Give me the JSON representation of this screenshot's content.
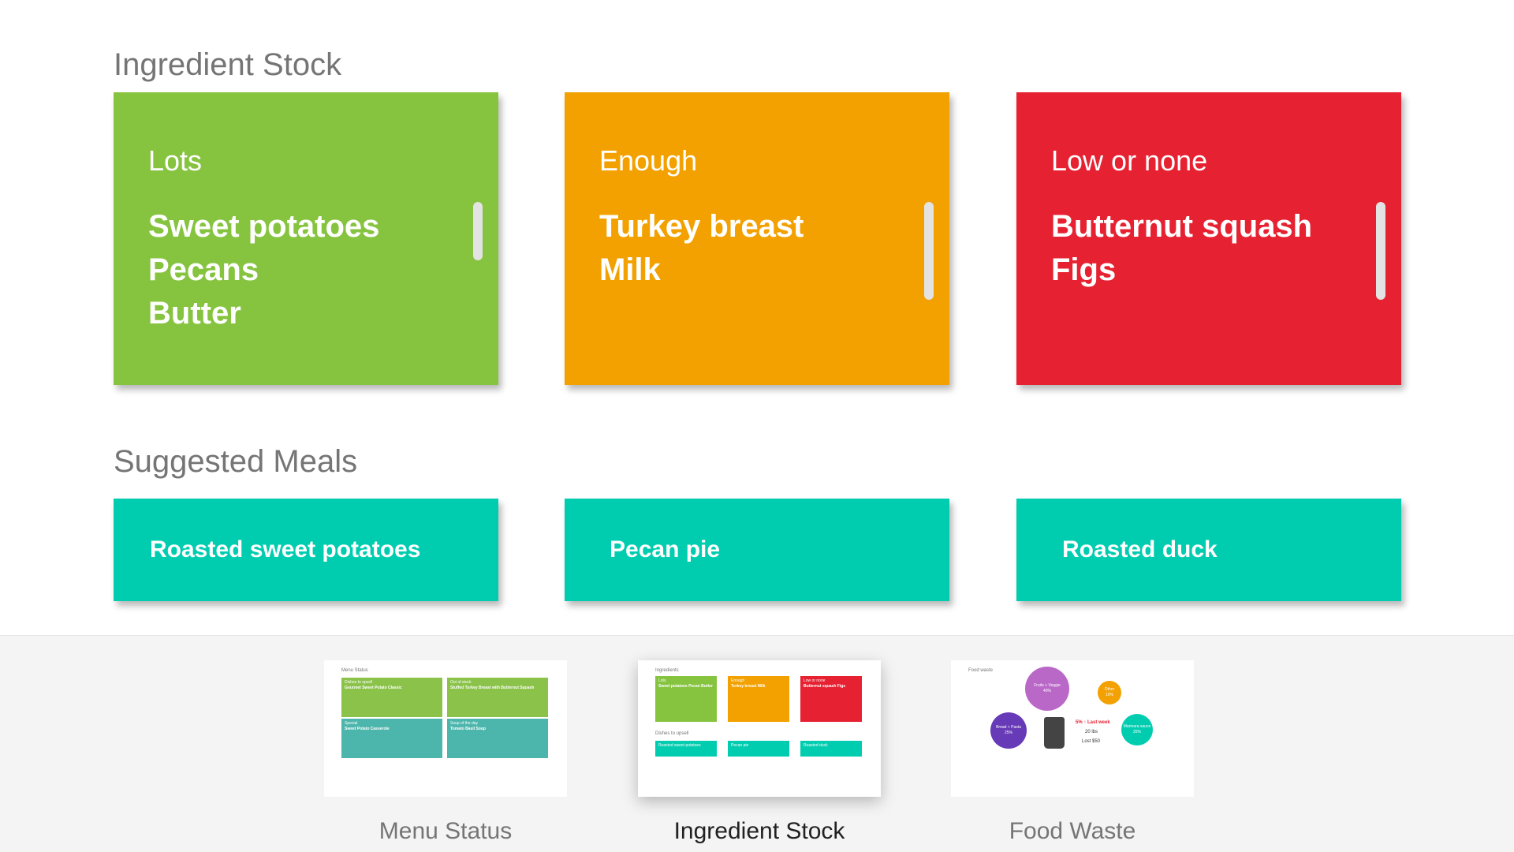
{
  "sections": {
    "stock_title": "Ingredient Stock",
    "meals_title": "Suggested Meals"
  },
  "stock": [
    {
      "heading": "Lots",
      "color": "#86c440",
      "items": [
        "Sweet potatoes",
        "Pecans",
        "Butter"
      ]
    },
    {
      "heading": "Enough",
      "color": "#f2a100",
      "items": [
        "Turkey breast",
        "Milk"
      ]
    },
    {
      "heading": "Low or none",
      "color": "#e62131",
      "items": [
        "Butternut squash",
        "Figs"
      ]
    }
  ],
  "meals": [
    {
      "label": "Roasted sweet potatoes",
      "color": "#00cdb0"
    },
    {
      "label": "Pecan pie",
      "color": "#00cdb0"
    },
    {
      "label": "Roasted duck",
      "color": "#00cdb0"
    }
  ],
  "nav": {
    "active": "Ingredient Stock",
    "items": [
      {
        "label": "Menu Status"
      },
      {
        "label": "Ingredient Stock"
      },
      {
        "label": "Food Waste"
      }
    ]
  },
  "thumbnails": {
    "menu_status": {
      "title": "Menu Status",
      "cards": [
        {
          "heading": "Dishes to upsell",
          "name": "Gourmet Sweet Potato Classic",
          "color": "#8bc34a"
        },
        {
          "heading": "Out of stock",
          "name": "Stuffed Turkey Breast with Butternut Squash",
          "color": "#8bc34a"
        },
        {
          "heading": "Special",
          "name": "Sweet Potato Casserole",
          "color": "#4db6ac"
        },
        {
          "heading": "Soup of the day",
          "name": "Tomato Basil Soup",
          "color": "#4db6ac"
        }
      ]
    },
    "ingredient_stock": {
      "title": "Ingredients",
      "cards": [
        {
          "heading": "Lots",
          "items": "Sweet potatoes Pecan Butter",
          "color": "#86c440"
        },
        {
          "heading": "Enough",
          "items": "Turkey breast Milk",
          "color": "#f2a100"
        },
        {
          "heading": "Low or none",
          "items": "Butternut squash Figs",
          "color": "#e62131"
        }
      ],
      "meals_title": "Dishes to upsell",
      "meals": [
        "Roasted sweet potatoes",
        "Pecan pie",
        "Roasted duck"
      ]
    },
    "food_waste": {
      "title": "Food waste",
      "segments": [
        {
          "label": "Fruits + Veggie",
          "percent": "40%",
          "color": "#ba68c8"
        },
        {
          "label": "Other",
          "percent": "10%",
          "color": "#f2a100"
        },
        {
          "label": "Bread + Pasta",
          "percent": "25%",
          "color": "#673ab7"
        },
        {
          "label": "Marinara sauce",
          "percent": "25%",
          "color": "#00cdb0"
        }
      ],
      "change": "5% ↑ Last week",
      "weight": "20 lbs",
      "lost": "Lost $50"
    }
  }
}
